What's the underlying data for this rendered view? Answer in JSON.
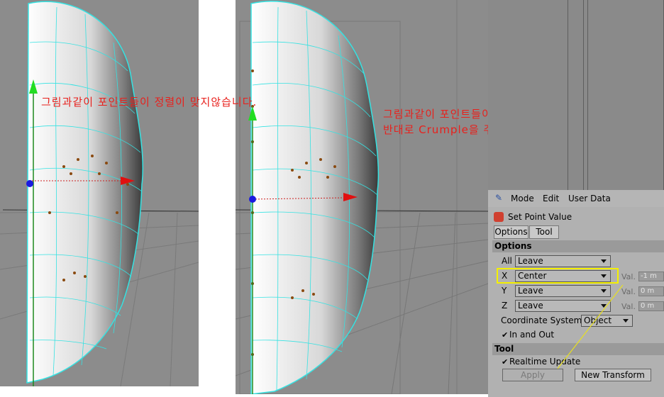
{
  "annotations": {
    "left_note": "그림과같이 포인트들이 정렬이 맞지않습니다.",
    "right_note_line1": "그림과같이 포인트들이 정렬이 됩니다.",
    "right_note_line2": "반대로 Crumple을 주시면 흩틀어집니다.",
    "color": "#e8201c"
  },
  "attribute_manager": {
    "menu": [
      "Mode",
      "Edit",
      "User Data"
    ],
    "tool_title": "Set Point Value",
    "tabs": [
      "Options",
      "Tool"
    ],
    "options_section": "Options",
    "rows": [
      {
        "label": "All",
        "value": "Leave"
      },
      {
        "label": "X",
        "value": "Center",
        "val_label": "Val.",
        "val": "-1 m"
      },
      {
        "label": "Y",
        "value": "Leave",
        "val_label": "Val.",
        "val": "0 m"
      },
      {
        "label": "Z",
        "value": "Leave",
        "val_label": "Val.",
        "val": "0 m"
      }
    ],
    "coordinate_system_label": "Coordinate System",
    "coordinate_system_value": "Object",
    "in_and_out_label": "In and Out",
    "in_and_out_checked": true,
    "tool_section": "Tool",
    "realtime_update_label": "Realtime Update",
    "realtime_update_checked": true,
    "apply_label": "Apply",
    "new_transform_label": "New Transform"
  },
  "colors": {
    "highlight": "#f4f000",
    "wire": "#35e2e2",
    "point": "#8a4a10"
  },
  "icons": {
    "menu_icon": "wrench-icon",
    "tool_icon": "set-point-value-icon",
    "checkbox": "checkmark-icon"
  }
}
